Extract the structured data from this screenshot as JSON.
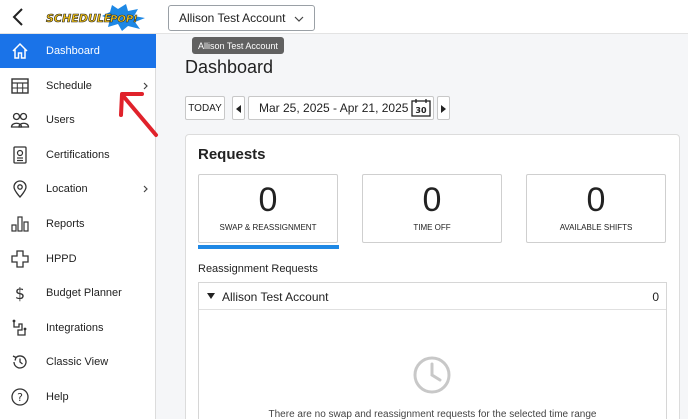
{
  "header": {
    "account_selected": "Allison Test Account",
    "tooltip": "Allison Test Account"
  },
  "sidebar": {
    "items": [
      {
        "label": "Dashboard",
        "icon": "home-icon",
        "active": true
      },
      {
        "label": "Schedule",
        "icon": "calendar-grid-icon",
        "submenu": true
      },
      {
        "label": "Users",
        "icon": "users-icon"
      },
      {
        "label": "Certifications",
        "icon": "certificate-icon"
      },
      {
        "label": "Location",
        "icon": "location-pin-icon",
        "submenu": true
      },
      {
        "label": "Reports",
        "icon": "bar-chart-icon"
      },
      {
        "label": "HPPD",
        "icon": "medical-cross-icon"
      },
      {
        "label": "Budget Planner",
        "icon": "dollar-icon"
      },
      {
        "label": "Integrations",
        "icon": "integrations-icon"
      },
      {
        "label": "Classic View",
        "icon": "history-icon"
      },
      {
        "label": "Help",
        "icon": "help-icon"
      }
    ]
  },
  "main": {
    "title": "Dashboard",
    "today_label": "TODAY",
    "date_range": "Mar 25, 2025 - Apr 21, 2025",
    "calendar_day": "30",
    "requests": {
      "title": "Requests",
      "stats": [
        {
          "value": "0",
          "caption": "SWAP & REASSIGNMENT"
        },
        {
          "value": "0",
          "caption": "TIME OFF"
        },
        {
          "value": "0",
          "caption": "AVAILABLE SHIFTS"
        }
      ],
      "section_label": "Reassignment Requests",
      "account_row": {
        "name": "Allison Test Account",
        "count": "0"
      },
      "empty_message": "There are no swap and reassignment requests for the selected time range"
    }
  },
  "colors": {
    "accent": "#1a73e8",
    "annotation": "#e0222b"
  }
}
